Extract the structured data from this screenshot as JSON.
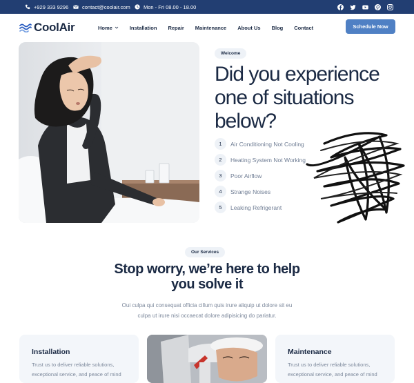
{
  "topbar": {
    "phone": "+929 333 9296",
    "email": "contact@coolair.com",
    "hours": "Mon - Fri 08.00 - 18.00",
    "social_icons": [
      "facebook-icon",
      "twitter-icon",
      "youtube-icon",
      "pinterest-icon",
      "instagram-icon"
    ]
  },
  "nav": {
    "logo": "CoolAir",
    "items": [
      {
        "label": "Home",
        "has_dropdown": true
      },
      {
        "label": "Installation"
      },
      {
        "label": "Repair"
      },
      {
        "label": "Maintenance"
      },
      {
        "label": "About Us"
      },
      {
        "label": "Blog"
      },
      {
        "label": "Contact"
      }
    ],
    "cta": "Schedule Now"
  },
  "hero": {
    "tag": "Welcome",
    "title_lines": [
      "Did you experience",
      "one of situations",
      "below?"
    ],
    "items": [
      {
        "num": "1",
        "text": "Air Conditioning Not Cooling"
      },
      {
        "num": "2",
        "text": "Heating System Not Working"
      },
      {
        "num": "3",
        "text": "Poor Airflow"
      },
      {
        "num": "4",
        "text": "Strange Noises"
      },
      {
        "num": "5",
        "text": "Leaking Refrigerant"
      }
    ]
  },
  "services": {
    "tag": "Our Services",
    "title_lines": [
      "Stop worry, we’re here to help",
      "you solve it"
    ],
    "desc_lines": [
      "Oui culpa qui consequat officia cillum quis irure aliquip ut dolore sit eu",
      "culpa ut irure nisi occaecat dolore adipisicing do pariatur."
    ],
    "cards": [
      {
        "title": "Installation",
        "text_lines": [
          "Trust us to deliver reliable solutions,",
          "exceptional service, and peace of mind"
        ]
      },
      {
        "title": "Maintenance",
        "text_lines": [
          "Trust us to deliver reliable solutions,",
          "exceptional service, and peace of mind"
        ]
      }
    ]
  },
  "colors": {
    "topbar": "#223e72",
    "accent": "#4f80c4",
    "heading": "#1b2a44",
    "muted": "#7c889b",
    "chip": "#eef2f7"
  }
}
